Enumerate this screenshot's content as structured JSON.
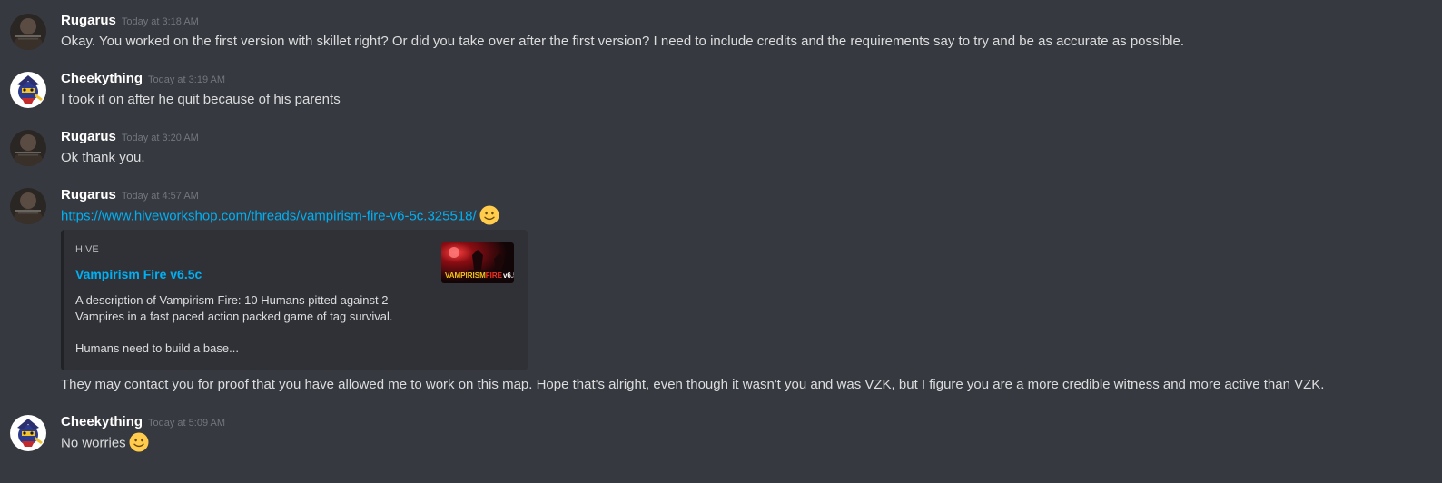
{
  "messages": [
    {
      "username": "Rugarus",
      "timestamp": "Today at 3:18 AM",
      "text": "Okay. You worked on the first version with skillet right? Or did you take over after the first version? I need to include credits and the requirements say to try and be as accurate as possible."
    },
    {
      "username": "Cheekything",
      "timestamp": "Today at 3:19 AM",
      "text": "I took it on after he quit because of his parents"
    },
    {
      "username": "Rugarus",
      "timestamp": "Today at 3:20 AM",
      "text": "Ok thank you."
    },
    {
      "username": "Rugarus",
      "timestamp": "Today at 4:57 AM",
      "link": "https://www.hiveworkshop.com/threads/vampirism-fire-v6-5c.325518/",
      "embed": {
        "provider": "HIVE",
        "title": "Vampirism Fire v6.5c",
        "description_line1": "A description of Vampirism Fire: 10 Humans pitted against 2 Vampires in a fast paced action packed game of tag survival.",
        "description_line2": "Humans need to build a base...",
        "thumbnail_text_1": "VAMPIRISM",
        "thumbnail_text_2": "FIRE",
        "thumbnail_text_3": "v6.5c"
      },
      "text": "They may contact you for proof that you have allowed me to work on this map. Hope that's alright, even though it wasn't you and was VZK, but I figure you are a more credible witness and more active than VZK."
    },
    {
      "username": "Cheekything",
      "timestamp": "Today at 5:09 AM",
      "text": "No worries"
    }
  ],
  "colors": {
    "background": "#36393f",
    "embed_background": "#2f3136",
    "link": "#00b0f4",
    "username": "#ffffff",
    "timestamp": "#72767d",
    "message_text": "#dcddde"
  }
}
